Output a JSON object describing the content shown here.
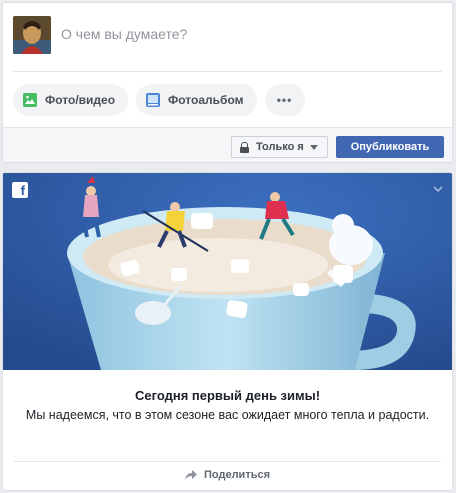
{
  "composer": {
    "prompt": "О чем вы думаете?",
    "chips": [
      {
        "label": "Фото/видео",
        "icon": "photo-video-icon",
        "color": "#45bd62"
      },
      {
        "label": "Фотоальбом",
        "icon": "photo-album-icon",
        "color": "#1877f2"
      }
    ],
    "more_label": "•••",
    "privacy_label": "Только я",
    "publish_label": "Опубликовать"
  },
  "story": {
    "badge": "f",
    "title": "Сегодня первый день зимы!",
    "text": "Мы надеемся, что в этом сезоне вас ожидает много тепла и радости.",
    "share_label": "Поделиться"
  },
  "colors": {
    "brand": "#4267b2",
    "hero_bg": "#2f5aa3",
    "page_bg": "#e9ebee"
  }
}
